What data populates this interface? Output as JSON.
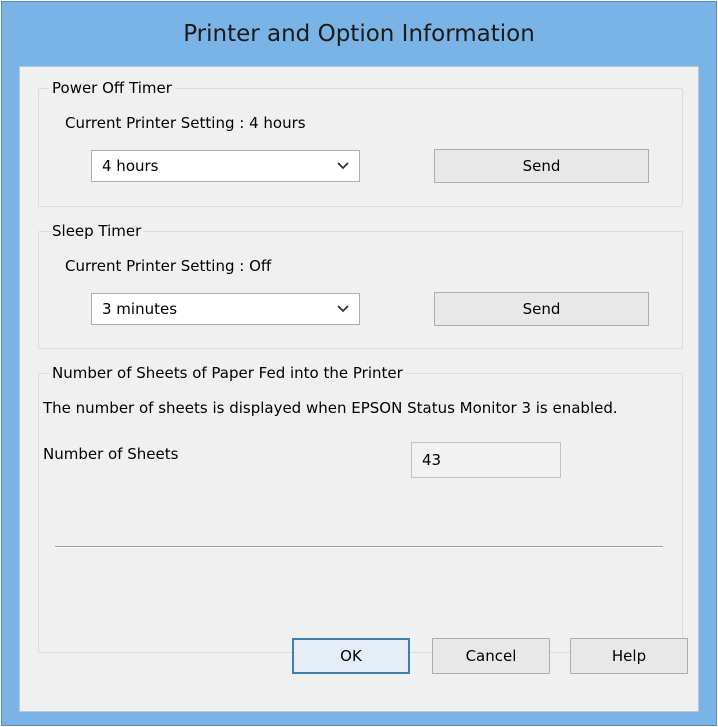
{
  "window": {
    "title": "Printer and Option Information"
  },
  "power_off_timer": {
    "legend": "Power Off Timer",
    "current_setting": "Current Printer Setting : 4 hours",
    "selected": "4 hours",
    "send_label": "Send"
  },
  "sleep_timer": {
    "legend": "Sleep Timer",
    "current_setting": "Current Printer Setting : Off",
    "selected": "3 minutes",
    "send_label": "Send"
  },
  "sheets": {
    "legend": "Number of Sheets of Paper Fed into the Printer",
    "info": "The number of sheets is displayed when EPSON Status Monitor 3 is enabled.",
    "label": "Number of Sheets",
    "value": "43"
  },
  "footer": {
    "ok_label": "OK",
    "cancel_label": "Cancel",
    "help_label": "Help"
  },
  "icons": {
    "dropdown": "chevron-down-icon"
  }
}
